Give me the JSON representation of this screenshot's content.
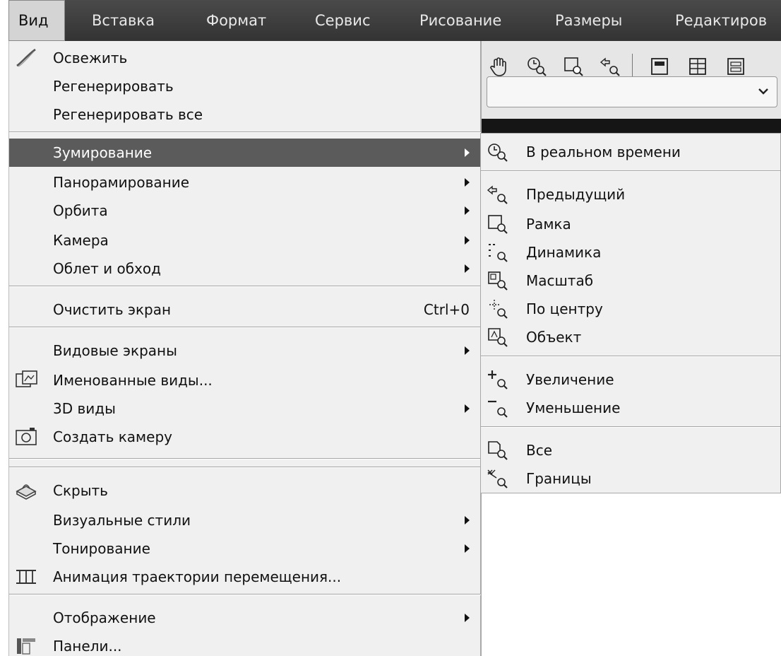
{
  "menubar": {
    "items": [
      "Вид",
      "Вставка",
      "Формат",
      "Сервис",
      "Рисование",
      "Размеры",
      "Редактиров"
    ]
  },
  "main_menu": {
    "items": [
      {
        "label": "Освежить",
        "icon": "redraw-brush-icon"
      },
      {
        "label": "Регенерировать"
      },
      {
        "label": "Регенерировать все"
      },
      {
        "label": "Зумирование",
        "has_submenu": true,
        "highlighted": true
      },
      {
        "label": "Панорамирование",
        "has_submenu": true
      },
      {
        "label": "Орбита",
        "has_submenu": true
      },
      {
        "label": "Камера",
        "has_submenu": true
      },
      {
        "label": "Облет и обход",
        "has_submenu": true
      },
      {
        "label": "Очистить экран",
        "shortcut": "Ctrl+0"
      },
      {
        "label": "Видовые экраны",
        "has_submenu": true
      },
      {
        "label": "Именованные виды...",
        "icon": "named-views-icon"
      },
      {
        "label": "3D виды",
        "has_submenu": true
      },
      {
        "label": "Создать камеру",
        "icon": "create-camera-icon"
      },
      {
        "label": "Скрыть",
        "icon": "hide-icon"
      },
      {
        "label": "Визуальные стили",
        "has_submenu": true
      },
      {
        "label": "Тонирование",
        "has_submenu": true
      },
      {
        "label": "Анимация траектории перемещения...",
        "icon": "motion-path-icon"
      },
      {
        "label": "Отображение",
        "has_submenu": true
      },
      {
        "label": "Панели...",
        "icon": "toolbars-icon"
      }
    ]
  },
  "zoom_submenu": {
    "items": [
      {
        "label": "В реальном времени",
        "icon": "zoom-realtime-icon"
      },
      {
        "label": "Предыдущий",
        "icon": "zoom-previous-icon"
      },
      {
        "label": "Рамка",
        "icon": "zoom-window-icon"
      },
      {
        "label": "Динамика",
        "icon": "zoom-dynamic-icon"
      },
      {
        "label": "Масштаб",
        "icon": "zoom-scale-icon"
      },
      {
        "label": "По центру",
        "icon": "zoom-center-icon"
      },
      {
        "label": "Объект",
        "icon": "zoom-object-icon"
      },
      {
        "label": "Увеличение",
        "icon": "zoom-in-icon"
      },
      {
        "label": "Уменьшение",
        "icon": "zoom-out-icon"
      },
      {
        "label": "Все",
        "icon": "zoom-all-icon"
      },
      {
        "label": "Границы",
        "icon": "zoom-extents-icon"
      }
    ]
  },
  "toolbar": {
    "icons": [
      "pan-hand-icon",
      "zoom-realtime-icon",
      "zoom-window-icon",
      "zoom-previous-icon",
      "properties-icon",
      "design-center-icon",
      "tool-palette-icon"
    ]
  },
  "colors": {
    "menubar_bg": "#3c3c3c",
    "menu_bg": "#f0f0f0",
    "highlight_bg": "#5b5b5b"
  }
}
